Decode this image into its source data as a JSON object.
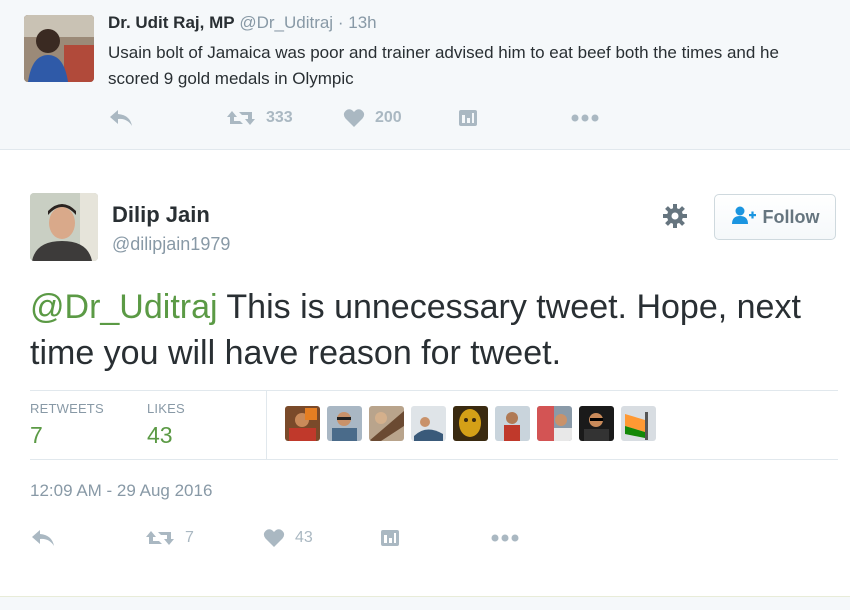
{
  "parent_tweet": {
    "name": "Dr. Udit Raj, MP",
    "handle": "@Dr_Uditraj",
    "separator": "·",
    "time": "13h",
    "text": "Usain bolt of Jamaica was poor and trainer advised him  to eat beef both the times and he scored 9 gold medals in Olympic",
    "retweet_count": "333",
    "like_count": "200"
  },
  "main_tweet": {
    "name": "Dilip Jain",
    "handle": "@dilipjain1979",
    "follow_label": "Follow",
    "mention": "@Dr_Uditraj",
    "text": " This is unnecessary tweet. Hope, next time you will have reason for tweet.",
    "stats": {
      "retweets_label": "RETWEETS",
      "retweets_value": "7",
      "likes_label": "LIKES",
      "likes_value": "43"
    },
    "timestamp": "12:09 AM - 29 Aug 2016",
    "retweet_count": "7",
    "like_count": "43"
  },
  "colors": {
    "accent": "#5b9a45",
    "muted": "#8899a6",
    "icon": "#aab8c2",
    "text": "#292f33",
    "parent_bg": "#f5f8fa"
  },
  "icons": {
    "reply": "reply-icon",
    "retweet": "retweet-icon",
    "like": "heart-icon",
    "analytics": "analytics-icon",
    "more": "more-icon",
    "settings": "gear-icon",
    "follow": "add-user-icon"
  }
}
